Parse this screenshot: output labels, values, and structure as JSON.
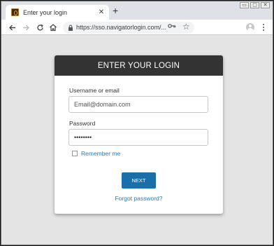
{
  "browser": {
    "tab_title": "Enter your login",
    "tab_close": "✕",
    "new_tab": "+",
    "url": "https://sso.navigatorlogin.com/...",
    "window_controls": [
      "▭",
      "▢",
      "✕"
    ]
  },
  "login": {
    "header": "ENTER YOUR LOGIN",
    "username_label": "Username or email",
    "username_placeholder": "Email@domain.com",
    "password_label": "Password",
    "password_value": "••••••••",
    "remember_label": "Remember me",
    "next_label": "NEXT",
    "forgot_label": "Forgot password?"
  },
  "colors": {
    "header_bg": "#333333",
    "accent": "#1b6fa8",
    "link": "#2878b0"
  }
}
